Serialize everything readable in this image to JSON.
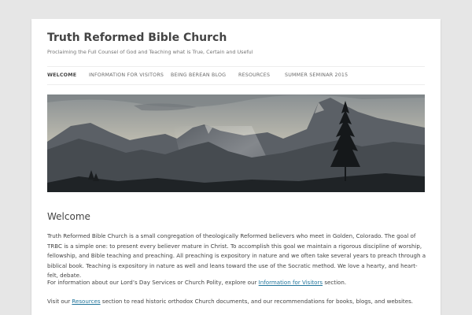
{
  "site": {
    "title": "Truth Reformed Bible Church",
    "tagline": "Proclaiming the Full Counsel of God and Teaching what is True, Certain and Useful"
  },
  "nav": {
    "items": [
      {
        "label": "Welcome",
        "active": true
      },
      {
        "label": "Information for Visitors",
        "active": false
      },
      {
        "label": "Being Berean Blog",
        "active": false
      },
      {
        "label": "Resources",
        "active": false
      },
      {
        "label": "Summer Seminar 2015",
        "active": false
      }
    ]
  },
  "header_image": {
    "subject": "mountain-landscape-with-pine-tree",
    "colors": {
      "sky_top": "#8a9093",
      "sky_bottom": "#dad6c4",
      "mountains": "#4a4f54",
      "foreground": "#1d2022"
    }
  },
  "content": {
    "title": "Welcome",
    "paragraph1": "Truth Reformed Bible Church is a small congregation of theologically Reformed believers who meet in Golden, Colorado. The goal of TRBC is a simple one: to present every believer mature in Christ. To accomplish this goal we maintain a rigorous discipline of worship, fellowship, and Bible teaching and preaching. All preaching is expository in nature and we often take several years to preach through a biblical book. Teaching is expository in nature as well and leans toward the use of the Socratic method. We love a hearty, and heart-felt, debate.",
    "paragraph2_before": "For information about our Lord’s Day Services or Church Polity, explore our ",
    "paragraph2_link": "Information for Visitors",
    "paragraph2_after": " section.",
    "paragraph3_before": "Visit our ",
    "paragraph3_link": "Resources",
    "paragraph3_after": " section to read historic orthodox Church documents, and our recommendations for books, blogs, and websites."
  },
  "colors": {
    "link": "#21759b",
    "background": "#e6e6e6",
    "page": "#ffffff"
  }
}
